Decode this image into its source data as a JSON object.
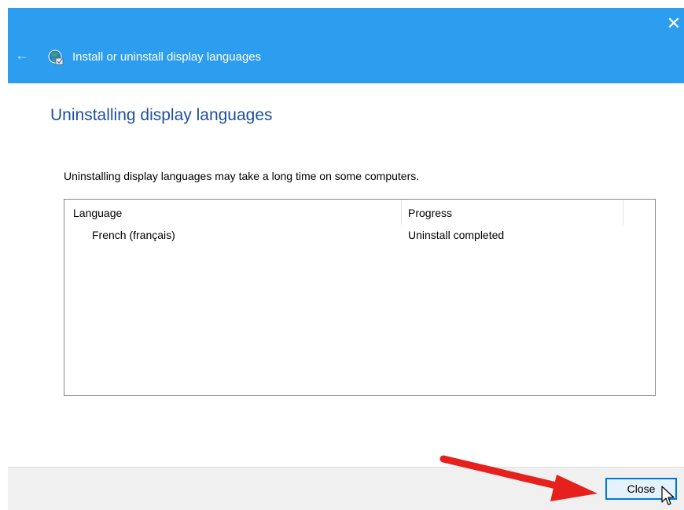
{
  "window": {
    "title": "Install or uninstall display languages",
    "close_glyph": "✕",
    "back_glyph": "←",
    "accent_color": "#2d9df0",
    "app_icon": "globe-language-icon"
  },
  "main": {
    "heading": "Uninstalling display languages",
    "description": "Uninstalling display languages may take a long time on some computers.",
    "list": {
      "columns": [
        "Language",
        "Progress"
      ],
      "rows": [
        {
          "language": "French (français)",
          "progress": "Uninstall completed"
        }
      ]
    }
  },
  "footer": {
    "close_label": "Close"
  },
  "annotation": {
    "arrow_color": "#e5201d",
    "arrow_icon": "red-arrow-icon",
    "cursor_icon": "mouse-pointer-icon"
  }
}
